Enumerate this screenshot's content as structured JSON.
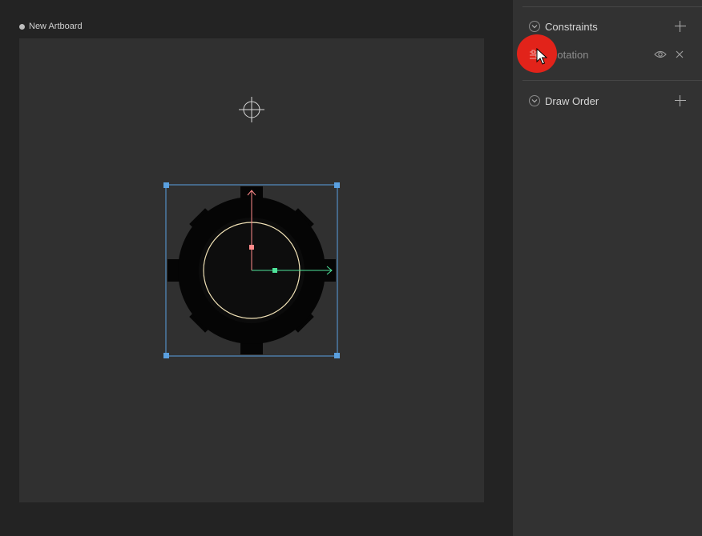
{
  "artboard": {
    "name": "New Artboard"
  },
  "panel": {
    "constraints": {
      "title": "Constraints",
      "items": [
        {
          "label": "Rotation"
        }
      ]
    },
    "draw_order": {
      "title": "Draw Order"
    }
  },
  "colors": {
    "selection": "#5aa0e0",
    "y_axis": "#ff8a8a",
    "x_axis": "#4ee49a",
    "click_indicator": "#e2231a",
    "gear_fill": "#050505",
    "ring_stroke": "#f3e4b8"
  },
  "icons": {
    "add": "plus-icon",
    "collapse": "chevron-down-icon",
    "visibility": "eye-icon",
    "delete": "close-icon",
    "target": "crosshair-icon",
    "constraint": "constraint-icon",
    "pointer": "mouse-cursor-icon"
  }
}
